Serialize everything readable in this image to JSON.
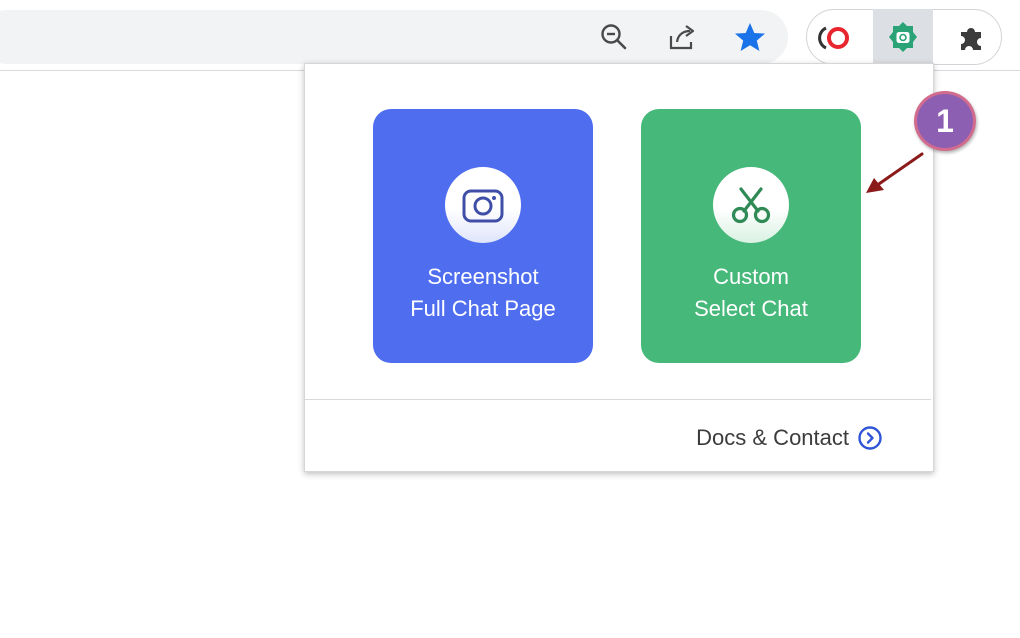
{
  "toolbar": {
    "icons": [
      "zoom-out-icon",
      "share-icon",
      "bookmark-star-icon"
    ],
    "extensions": [
      "opera-extension-icon",
      "chat-screenshot-extension-icon",
      "extensions-puzzle-icon"
    ],
    "colors": {
      "star": "#1a73e8",
      "opera": "#e8242f",
      "extension_accent": "#2aa476"
    }
  },
  "popup": {
    "cards": [
      {
        "label": "Screenshot\nFull Chat Page",
        "icon": "camera-icon",
        "color": "#4f6def"
      },
      {
        "label": "Custom\nSelect Chat",
        "icon": "scissors-icon",
        "color": "#46b87a"
      }
    ],
    "footer": {
      "label": "Docs & Contact",
      "icon": "chevron-right-circle-icon",
      "color": "#2f54d6"
    }
  },
  "annotation": {
    "badge_number": "1",
    "badge_color": "#8d5fb3",
    "arrow_color": "#8b1a1a"
  }
}
